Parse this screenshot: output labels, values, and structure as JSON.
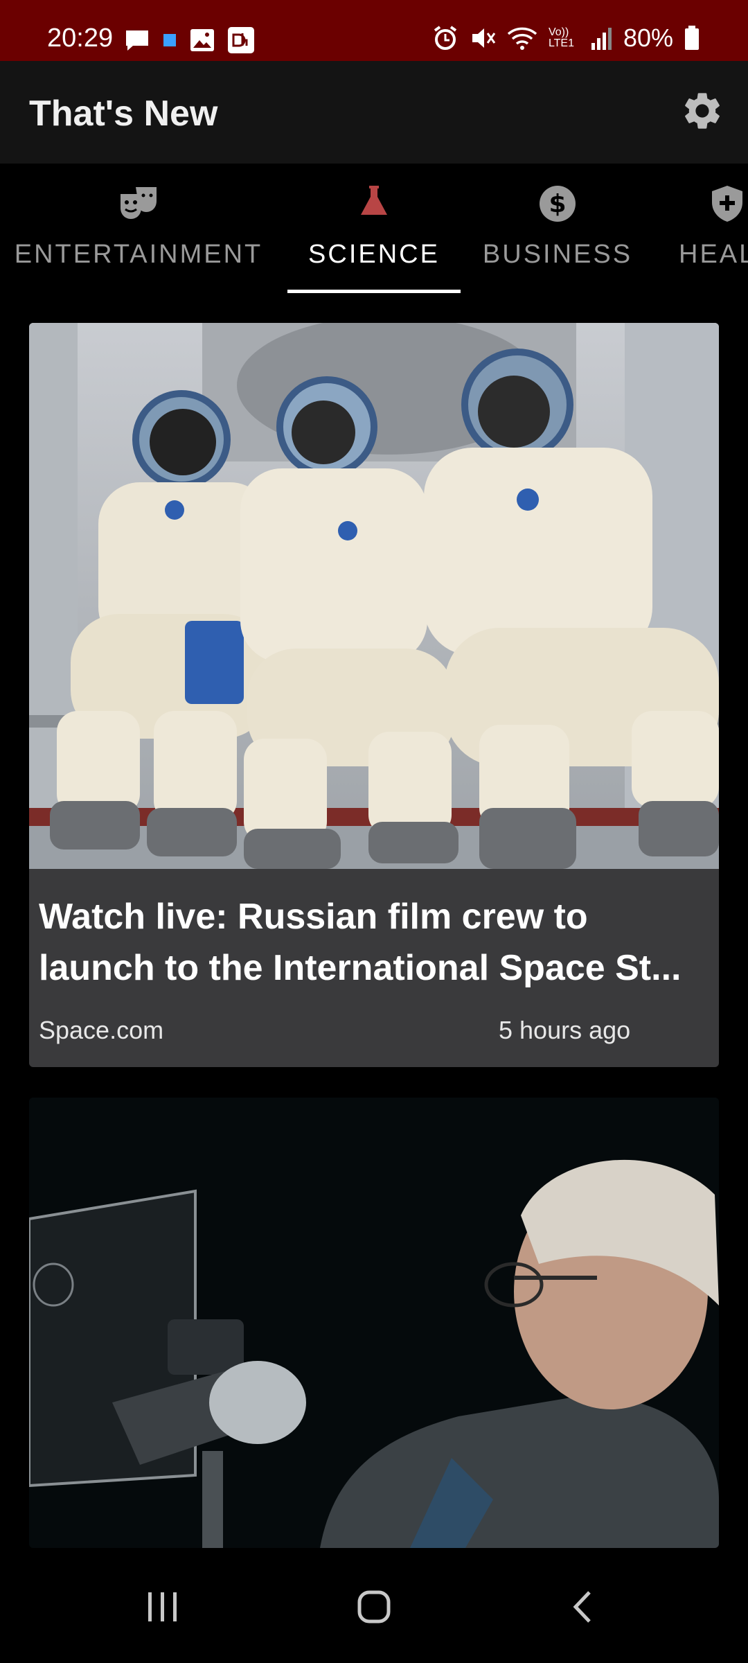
{
  "status_bar": {
    "time": "20:29",
    "battery": "80%",
    "network_label": "Vo)) LTE1"
  },
  "app_bar": {
    "title": "That's New",
    "settings_icon": "gear-icon"
  },
  "tabs": [
    {
      "label": "ENTERTAINMENT",
      "icon": "theater-masks-icon",
      "active": false
    },
    {
      "label": "SCIENCE",
      "icon": "flask-icon",
      "active": true
    },
    {
      "label": "BUSINESS",
      "icon": "dollar-icon",
      "active": false
    },
    {
      "label": "HEAL",
      "icon": "shield-plus-icon",
      "active": false
    }
  ],
  "colors": {
    "status_bar": "#6b0000",
    "app_bar": "#141414",
    "card": "#3a3a3c",
    "science_accent": "#b84545"
  },
  "articles": [
    {
      "headline": "Watch live: Russian film crew to launch to the International Space St...",
      "source": "Space.com",
      "time_ago": "5 hours ago"
    }
  ]
}
